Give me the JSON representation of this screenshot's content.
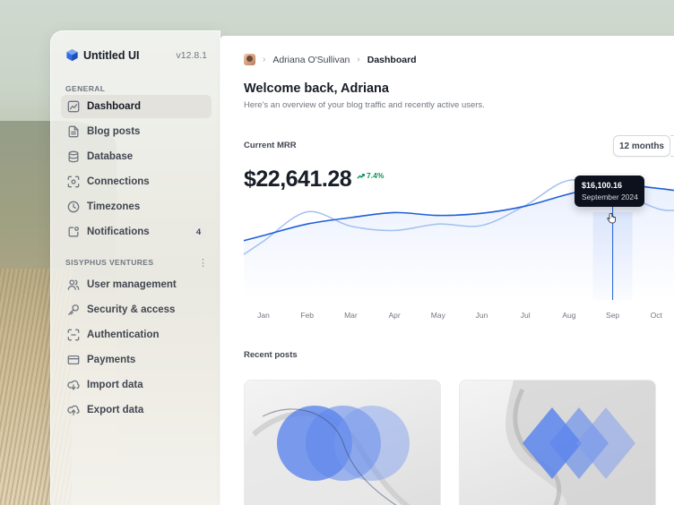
{
  "brand": {
    "name": "Untitled UI",
    "version": "v12.8.1"
  },
  "sidebar": {
    "general_label": "GENERAL",
    "general_items": [
      {
        "label": "Dashboard",
        "icon": "chart-icon",
        "active": true
      },
      {
        "label": "Blog posts",
        "icon": "file-icon"
      },
      {
        "label": "Database",
        "icon": "database-icon"
      },
      {
        "label": "Connections",
        "icon": "connections-icon"
      },
      {
        "label": "Timezones",
        "icon": "clock-icon"
      },
      {
        "label": "Notifications",
        "icon": "notification-icon",
        "badge": "4"
      }
    ],
    "workspace_label": "SISYPHUS VENTURES",
    "workspace_items": [
      {
        "label": "User management",
        "icon": "users-icon"
      },
      {
        "label": "Security & access",
        "icon": "key-icon"
      },
      {
        "label": "Authentication",
        "icon": "scan-icon"
      },
      {
        "label": "Payments",
        "icon": "credit-card-icon"
      },
      {
        "label": "Import data",
        "icon": "cloud-download-icon"
      },
      {
        "label": "Export data",
        "icon": "cloud-upload-icon"
      }
    ]
  },
  "breadcrumb": {
    "user": "Adriana O'Sullivan",
    "current": "Dashboard"
  },
  "header": {
    "title": "Welcome back, Adriana",
    "subtitle": "Here's an overview of your blog traffic and recently active users."
  },
  "mrr": {
    "label": "Current MRR",
    "value": "$22,641.28",
    "change": "7.4%",
    "range_button": "12 months"
  },
  "tooltip": {
    "value": "$16,100.16",
    "date": "September 2024"
  },
  "recent": {
    "label": "Recent posts"
  },
  "colors": {
    "accent": "#1f5fd8",
    "accent_light": "#9bbcef",
    "positive": "#079455"
  },
  "chart_data": {
    "type": "line",
    "categories": [
      "Jan",
      "Feb",
      "Mar",
      "Apr",
      "May",
      "Jun",
      "Jul",
      "Aug",
      "Sep",
      "Oct"
    ],
    "ylim": [
      0,
      20000
    ],
    "grid": false,
    "highlighted_category": "Sep",
    "series": [
      {
        "values": [
          9000,
          10600,
          11500,
          12200,
          11800,
          12100,
          13100,
          14800,
          16100,
          15600
        ]
      },
      {
        "values": [
          8200,
          12300,
          10300,
          9700,
          10600,
          10400,
          13200,
          16700,
          15300,
          12800
        ]
      }
    ]
  }
}
